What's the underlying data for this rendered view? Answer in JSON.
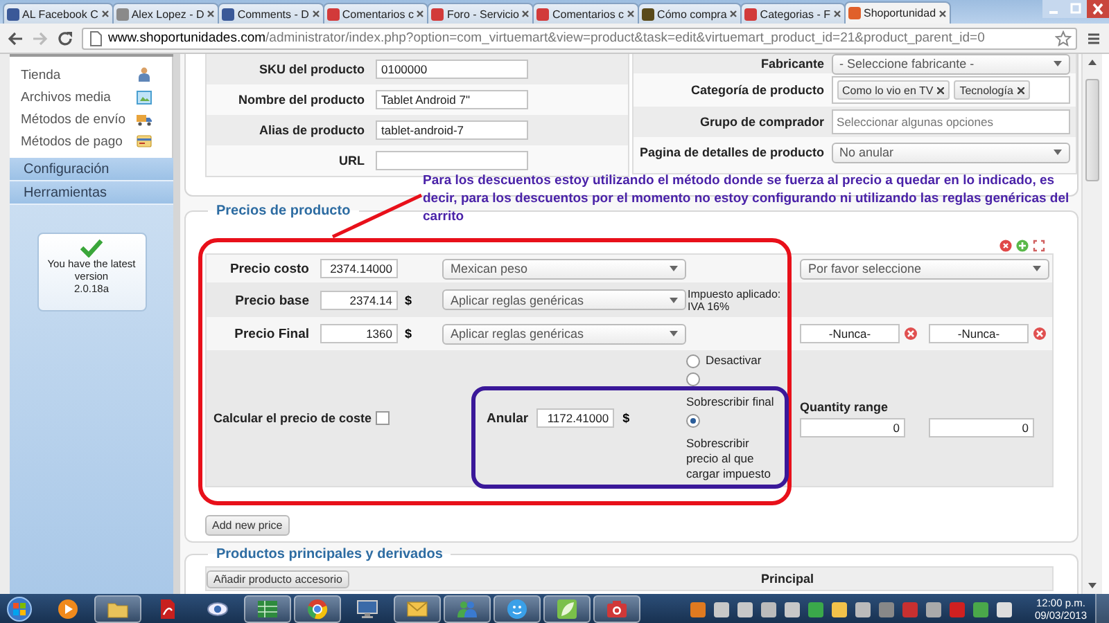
{
  "browser": {
    "tabs": [
      {
        "title": "AL Facebook C",
        "color": "#3b5998",
        "selected": false
      },
      {
        "title": "Alex Lopez - D",
        "color": "#8a8a8a",
        "selected": false
      },
      {
        "title": "Comments - D",
        "color": "#3b5998",
        "selected": false
      },
      {
        "title": "Comentarios c",
        "color": "#d23a3a",
        "selected": false
      },
      {
        "title": "Foro - Servicio",
        "color": "#d23a3a",
        "selected": false
      },
      {
        "title": "Comentarios c",
        "color": "#d23a3a",
        "selected": false
      },
      {
        "title": "Cómo compra",
        "color": "#5a4a1a",
        "selected": false
      },
      {
        "title": "Categorias - F",
        "color": "#d23a3a",
        "selected": false
      },
      {
        "title": "Shoportunidad",
        "color": "#e0602a",
        "selected": true
      }
    ],
    "address": {
      "host": "www.shoportunidades.com",
      "path": "/administrator/index.php?option=com_virtuemart&view=product&task=edit&virtuemart_product_id=21&product_parent_id=0"
    }
  },
  "sidebar": {
    "items": [
      {
        "label": "Tienda",
        "kind": "store"
      },
      {
        "label": "Archivos media",
        "kind": "media"
      },
      {
        "label": "Métodos de envío",
        "kind": "shipping"
      },
      {
        "label": "Métodos de pago",
        "kind": "payment"
      }
    ],
    "sections": [
      {
        "label": "Configuración"
      },
      {
        "label": "Herramientas"
      }
    ],
    "version_box": {
      "message": "You have the latest version",
      "version": "2.0.18a"
    }
  },
  "product_details": {
    "left_rows": [
      {
        "label": "SKU del producto",
        "value": "0100000"
      },
      {
        "label": "Nombre del producto",
        "value": "Tablet Android 7\""
      },
      {
        "label": "Alias de producto",
        "value": "tablet-android-7"
      },
      {
        "label": "URL"
      }
    ],
    "right_rows": [
      {
        "label": "Fabricante",
        "kind": "select",
        "value": "- Seleccione fabricante -"
      },
      {
        "label": "Categoría de producto",
        "kind": "tags",
        "tags": [
          "Como lo vio en TV",
          "Tecnología"
        ]
      },
      {
        "label": "Grupo de comprador",
        "kind": "multiselect",
        "placeholder": "Seleccionar algunas opciones"
      },
      {
        "label": "Pagina de detalles de producto",
        "kind": "select",
        "value": "No anular"
      }
    ]
  },
  "annotation": {
    "note": "Para los descuentos estoy utilizando el método donde se fuerza al precio a quedar en lo indicado, es decir, para los descuentos por el momento no estoy configurando ni utilizando las reglas genéricas del carrito"
  },
  "prices": {
    "legend": "Precios de producto",
    "rows": [
      {
        "label": "Precio costo",
        "value": "2374.14000",
        "dropdown": "Mexican peso",
        "kind": "currency",
        "select": "Por favor seleccione"
      },
      {
        "label": "Precio base",
        "value": "2374.14",
        "unit": "$",
        "dropdown": "Aplicar reglas genéricas",
        "kind": "tax",
        "tax_label": "Impuesto aplicado:",
        "tax_value": "IVA 16%"
      },
      {
        "label": "Precio Final",
        "value": "1360",
        "unit": "$",
        "dropdown": "Aplicar reglas genéricas",
        "kind": "dates",
        "dates": [
          "-Nunca-",
          "-Nunca-"
        ]
      }
    ],
    "calc_cost": {
      "label": "Calcular el precio de coste",
      "checked": false
    },
    "override": {
      "label": "Anular",
      "value": "1172.41000",
      "unit": "$",
      "options": [
        {
          "label": "Desactivar",
          "selected": false
        },
        {
          "label": "Sobrescribir final",
          "selected": false
        },
        {
          "label": "Sobrescribir precio al que cargar impuesto",
          "selected": true
        }
      ]
    },
    "quantity_range": {
      "label": "Quantity range",
      "from": "0",
      "to": "0"
    },
    "add_button": "Add new price"
  },
  "related": {
    "legend": "Productos principales y derivados",
    "button": "Añadir producto accesorio",
    "column": "Principal"
  },
  "taskbar": {
    "apps": [
      {
        "kind": "player",
        "running": false
      },
      {
        "kind": "folder",
        "running": true
      },
      {
        "kind": "pdf",
        "running": false
      },
      {
        "kind": "eye",
        "running": false
      },
      {
        "kind": "spreadsheet",
        "running": true
      },
      {
        "kind": "browser",
        "running": true
      },
      {
        "kind": "computer",
        "running": false
      },
      {
        "kind": "mail",
        "running": true
      },
      {
        "kind": "people",
        "running": true
      },
      {
        "kind": "chat",
        "running": true
      },
      {
        "kind": "leaf",
        "running": true
      },
      {
        "kind": "camera",
        "running": true
      }
    ],
    "time": "12:00 p.m.",
    "date": "09/03/2013"
  }
}
